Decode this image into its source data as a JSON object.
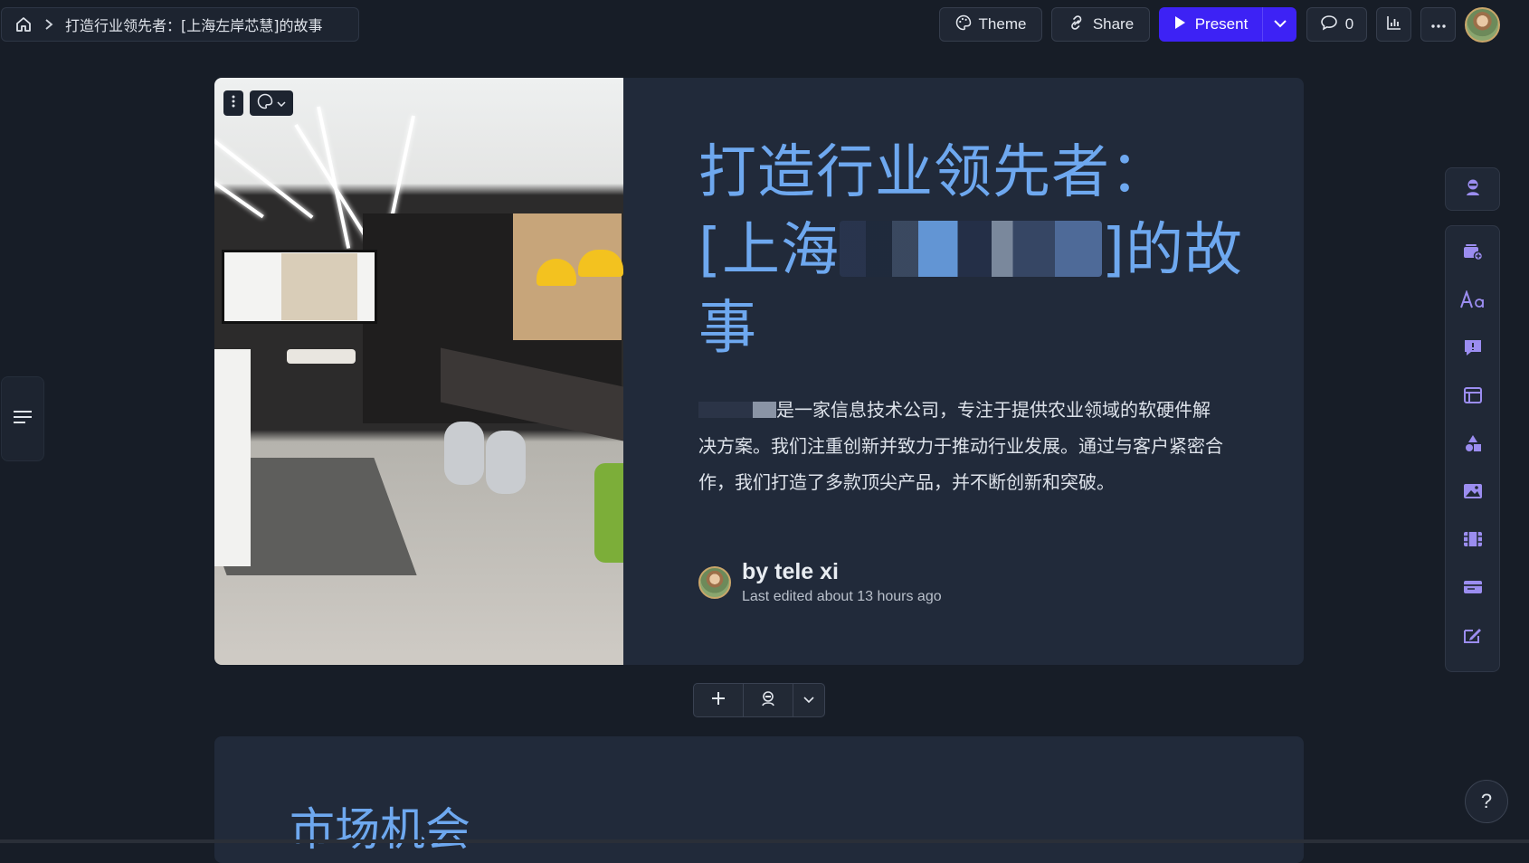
{
  "breadcrumb": {
    "title": "打造行业领先者：[上海左岸芯慧]的故事"
  },
  "toolbar": {
    "theme_label": "Theme",
    "share_label": "Share",
    "present_label": "Present",
    "comments_count": "0"
  },
  "card": {
    "headline_line1": "打造行业领先者：",
    "headline_open": "[上海",
    "headline_close": "]的故",
    "headline_line3": "事",
    "description": "是一家信息技术公司，专注于提供农业领域的软硬件解决方案。我们注重创新并致力于推动行业发展。通过与客户紧密合作，我们打造了多款顶尖产品，并不断创新和突破。",
    "author_name": "by tele xi",
    "last_edited": "Last edited about 13 hours ago"
  },
  "next_card": {
    "title": "市场机会"
  },
  "help_label": "?",
  "colors": {
    "accent": "#6ea8ef",
    "present": "#3d22f5",
    "background": "#171d27",
    "card": "#212a3a",
    "tool_icon": "#9b8df0"
  },
  "icons": [
    "home-icon",
    "chevron-right-icon",
    "palette-icon",
    "link-icon",
    "play-icon",
    "chevron-down-icon",
    "comment-icon",
    "analytics-icon",
    "more-icon",
    "outline-icon",
    "ai-assistant-icon",
    "add-card-icon",
    "text-icon",
    "callout-icon",
    "layout-icon",
    "shapes-icon",
    "image-icon",
    "video-icon",
    "embed-icon",
    "edit-icon"
  ]
}
